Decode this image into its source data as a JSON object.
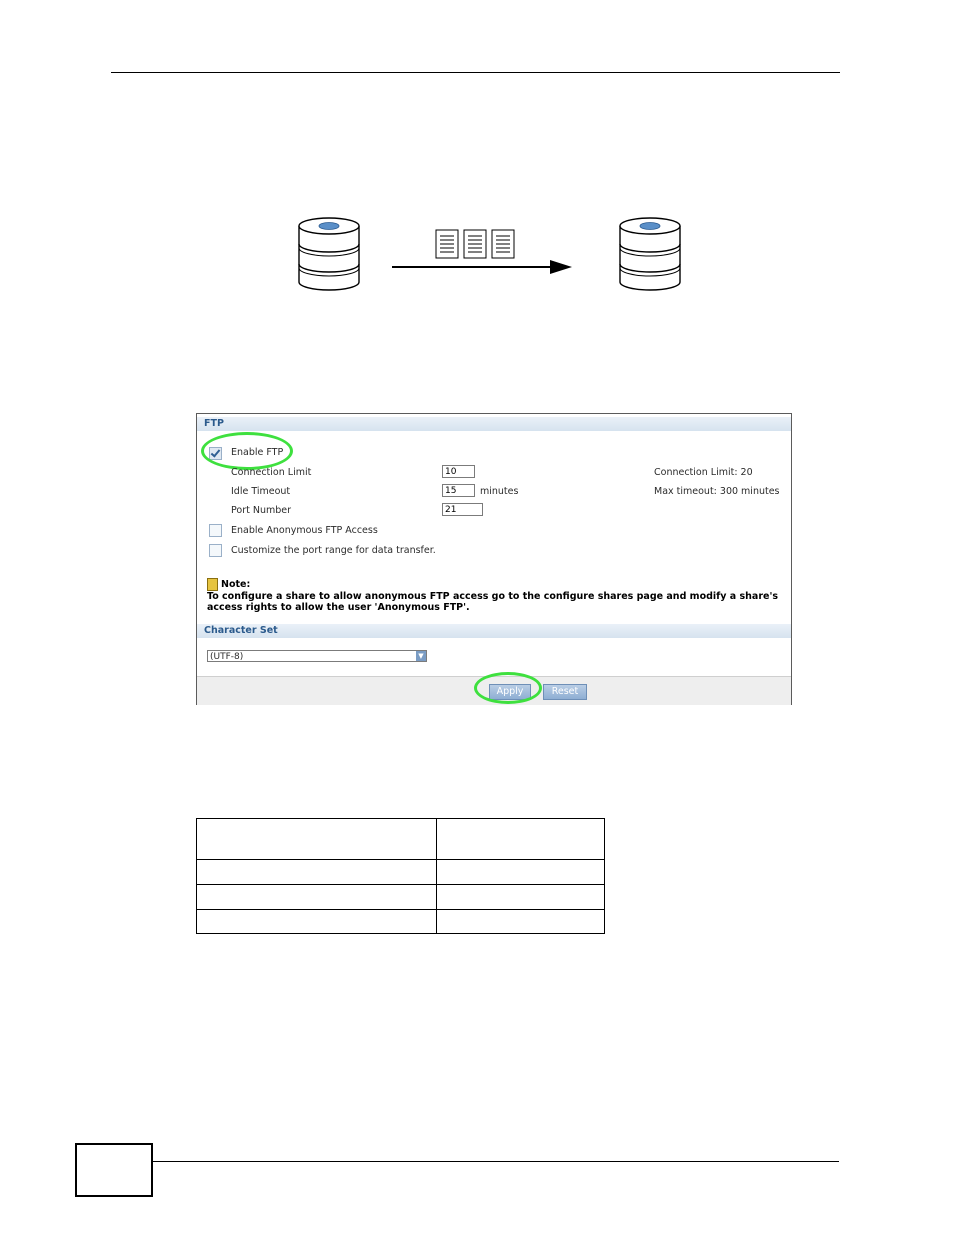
{
  "diagram": {
    "source_icon": "database-server-icon",
    "target_icon": "database-server-icon",
    "files_icon": "documents-icon",
    "arrow_icon": "arrow-right-icon"
  },
  "ftp_panel": {
    "section_title": "FTP",
    "enable_ftp": {
      "label": "Enable FTP",
      "checked": true
    },
    "fields": {
      "connection_limit": {
        "label": "Connection Limit",
        "value": "10",
        "hint": "Connection Limit: 20"
      },
      "idle_timeout": {
        "label": "Idle Timeout",
        "value": "15",
        "unit": "minutes",
        "hint": "Max timeout: 300 minutes"
      },
      "port_number": {
        "label": "Port Number",
        "value": "21"
      }
    },
    "anonymous_access": {
      "label": "Enable Anonymous FTP Access",
      "checked": false
    },
    "port_range": {
      "label": "Customize the port range for data transfer.",
      "checked": false
    },
    "note": {
      "icon": "note-icon",
      "title": "Note:",
      "line1": "To configure a share to allow anonymous FTP access go to the configure shares page and modify a share's",
      "line2": "access rights to allow the user 'Anonymous FTP'."
    },
    "charset_title": "Character Set",
    "charset_value": "(UTF-8)",
    "apply_label": "Apply",
    "reset_label": "Reset"
  },
  "colors": {
    "highlight_ring": "#3ee03e",
    "section_text": "#2b5a8c",
    "button": "#8eaed3"
  }
}
